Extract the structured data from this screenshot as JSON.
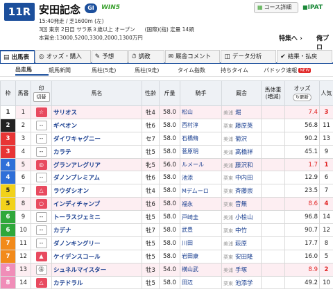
{
  "header": {
    "race_number": "11R",
    "race_name": "安田記念",
    "grade": "GI",
    "win5": "WIN5",
    "course_button": "コース詳細",
    "ipat": "IPAT",
    "line1": "15:40発走 / 芝1600m (左)",
    "line2": "3回 東京 2日目 サラ系３歳以上 オープン",
    "line2_reg": "(国際)(指) 定量 14頭",
    "line3": "本賞金:13000,5200,3300,2000,1300万円",
    "tokusen": "特集へ",
    "ore": "俺プロ"
  },
  "tabs": [
    {
      "label": "出馬表",
      "icon": "table-icon",
      "active": true
    },
    {
      "label": "オッズ・購入",
      "icon": "coin-icon",
      "active": false
    },
    {
      "label": "予想",
      "icon": "forecast-icon",
      "active": false
    },
    {
      "label": "調教",
      "icon": "training-icon",
      "active": false
    },
    {
      "label": "厩舎コメント",
      "icon": "comment-icon",
      "active": false
    },
    {
      "label": "データ分析",
      "icon": "chart-icon",
      "active": false
    },
    {
      "label": "結果・払戻",
      "icon": "result-icon",
      "active": false
    }
  ],
  "subtabs": [
    {
      "label": "出走馬",
      "active": true
    },
    {
      "label": "競馬新聞",
      "active": false
    },
    {
      "label": "馬柱(5走)",
      "active": false
    },
    {
      "label": "馬柱(9走)",
      "active": false
    },
    {
      "label": "タイム指数",
      "active": false
    },
    {
      "label": "持ちタイム",
      "active": false
    },
    {
      "label": "パドック速報",
      "active": false
    }
  ],
  "new_badge": "NEW",
  "columns": {
    "waku": "枠",
    "umaban": "馬番",
    "mark": "印",
    "mark_switch": "切替",
    "horse": "馬名",
    "sexage": "性齢",
    "weight": "斤量",
    "jockey": "騎手",
    "stable": "厩舎",
    "body": "馬体重",
    "body_sub": "(増減)",
    "odds": "オッズ",
    "refresh": "更新",
    "pop": "人気"
  },
  "rows": [
    {
      "waku": "1",
      "uma": "1",
      "mark": "☆",
      "mark_bg": "#e84a5f",
      "horse": "サリオス",
      "sexage": "牡4",
      "kin": "58.0",
      "jockey": "松山",
      "stable": "美浦",
      "trainer": "堀",
      "odds": "7.4",
      "odds_red": true,
      "pop": "3",
      "pink": true
    },
    {
      "waku": "2",
      "uma": "2",
      "mark": "--",
      "mark_bg": "",
      "horse": "ギベオン",
      "sexage": "牡6",
      "kin": "58.0",
      "jockey": "西村淳",
      "stable": "栗東",
      "trainer": "藤原英",
      "odds": "56.8",
      "odds_red": false,
      "pop": "11",
      "pink": false
    },
    {
      "waku": "3",
      "uma": "3",
      "mark": "--",
      "mark_bg": "",
      "horse": "ダイワキャグニー",
      "sexage": "セ7",
      "kin": "58.0",
      "jockey": "石橋脩",
      "stable": "美浦",
      "trainer": "菊沢",
      "odds": "90.2",
      "odds_red": false,
      "pop": "13",
      "pink": false
    },
    {
      "waku": "3",
      "uma": "4",
      "mark": "--",
      "mark_bg": "",
      "horse": "カラテ",
      "sexage": "牡5",
      "kin": "58.0",
      "jockey": "菅原明",
      "stable": "美浦",
      "trainer": "高橋祥",
      "odds": "45.1",
      "odds_red": false,
      "pop": "9",
      "pink": false
    },
    {
      "waku": "4",
      "uma": "5",
      "mark": "◎",
      "mark_bg": "#e84a5f",
      "horse": "グランアレグリア",
      "sexage": "牝5",
      "kin": "56.0",
      "jockey": "ルメール",
      "stable": "美浦",
      "trainer": "藤沢和",
      "odds": "1.7",
      "odds_red": true,
      "pop": "1",
      "pink": true
    },
    {
      "waku": "4",
      "uma": "6",
      "mark": "--",
      "mark_bg": "",
      "horse": "ダノンプレミアム",
      "sexage": "牡6",
      "kin": "58.0",
      "jockey": "池添",
      "stable": "栗東",
      "trainer": "中内田",
      "odds": "12.9",
      "odds_red": false,
      "pop": "6",
      "pink": false
    },
    {
      "waku": "5",
      "uma": "7",
      "mark": "△",
      "mark_bg": "#e84a5f",
      "horse": "ラウダシオン",
      "sexage": "牡4",
      "kin": "58.0",
      "jockey": "Mデムーロ",
      "stable": "栗東",
      "trainer": "斉藤崇",
      "odds": "23.5",
      "odds_red": false,
      "pop": "7",
      "pink": false
    },
    {
      "waku": "5",
      "uma": "8",
      "mark": "○",
      "mark_bg": "#e84a5f",
      "horse": "インディチャンプ",
      "sexage": "牡6",
      "kin": "58.0",
      "jockey": "福永",
      "stable": "栗東",
      "trainer": "音無",
      "odds": "8.6",
      "odds_red": true,
      "pop": "4",
      "pink": true
    },
    {
      "waku": "6",
      "uma": "9",
      "mark": "--",
      "mark_bg": "",
      "horse": "トーラスジェミニ",
      "sexage": "牡5",
      "kin": "58.0",
      "jockey": "戸崎圭",
      "stable": "美浦",
      "trainer": "小桧山",
      "odds": "96.8",
      "odds_red": false,
      "pop": "14",
      "pink": false
    },
    {
      "waku": "6",
      "uma": "10",
      "mark": "--",
      "mark_bg": "",
      "horse": "カデナ",
      "sexage": "牡7",
      "kin": "58.0",
      "jockey": "武豊",
      "stable": "栗東",
      "trainer": "中竹",
      "odds": "90.7",
      "odds_red": false,
      "pop": "12",
      "pink": false
    },
    {
      "waku": "7",
      "uma": "11",
      "mark": "--",
      "mark_bg": "",
      "horse": "ダノンキングリー",
      "sexage": "牡5",
      "kin": "58.0",
      "jockey": "川田",
      "stable": "美浦",
      "trainer": "萩原",
      "odds": "17.7",
      "odds_red": false,
      "pop": "8",
      "pink": false
    },
    {
      "waku": "7",
      "uma": "12",
      "mark": "▲",
      "mark_bg": "#e84a5f",
      "horse": "ケイデンスコール",
      "sexage": "牡5",
      "kin": "58.0",
      "jockey": "岩田康",
      "stable": "栗東",
      "trainer": "安田隆",
      "odds": "16.0",
      "odds_red": false,
      "pop": "5",
      "pink": false
    },
    {
      "waku": "8",
      "uma": "13",
      "mark": "㊟",
      "mark_bg": "",
      "horse": "シュネルマイスター",
      "sexage": "牡3",
      "kin": "54.0",
      "jockey": "横山武",
      "stable": "美浦",
      "trainer": "手塚",
      "odds": "8.9",
      "odds_red": true,
      "pop": "2",
      "pink": true
    },
    {
      "waku": "8",
      "uma": "14",
      "mark": "△",
      "mark_bg": "#e84a5f",
      "horse": "カテドラル",
      "sexage": "牡5",
      "kin": "58.0",
      "jockey": "田辺",
      "stable": "栗東",
      "trainer": "池添学",
      "odds": "49.2",
      "odds_red": false,
      "pop": "10",
      "pink": false
    }
  ],
  "waku_colors": {
    "1": {
      "bg": "#ffffff",
      "fg": "#222222"
    },
    "2": {
      "bg": "#222222",
      "fg": "#ffffff"
    },
    "3": {
      "bg": "#e83535",
      "fg": "#ffffff"
    },
    "4": {
      "bg": "#2f6fd8",
      "fg": "#ffffff"
    },
    "5": {
      "bg": "#f2d21a",
      "fg": "#222222"
    },
    "6": {
      "bg": "#2fa83a",
      "fg": "#ffffff"
    },
    "7": {
      "bg": "#f28a1a",
      "fg": "#ffffff"
    },
    "8": {
      "bg": "#f08db8",
      "fg": "#ffffff"
    }
  }
}
